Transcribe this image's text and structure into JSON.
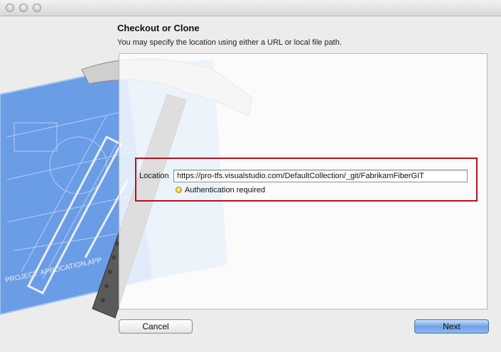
{
  "window": {
    "controls": [
      "close-button",
      "minimize-button",
      "zoom-button"
    ]
  },
  "header": {
    "title": "Checkout or Clone",
    "description": "You may specify the location using either a URL or local file path."
  },
  "location": {
    "label": "Location",
    "value": "https://pro-tfs.visualstudio.com/DefaultCollection/_git/FabrikamFiberGIT"
  },
  "status": {
    "text": "Authentication required",
    "color": "#e8b400"
  },
  "artwork": {
    "blueprint_label": "PROJECT: APPLICATION.APP"
  },
  "footer": {
    "cancel_label": "Cancel",
    "next_label": "Next"
  },
  "colors": {
    "highlight_border": "#b5121b",
    "default_button": "#6fa1e6"
  }
}
